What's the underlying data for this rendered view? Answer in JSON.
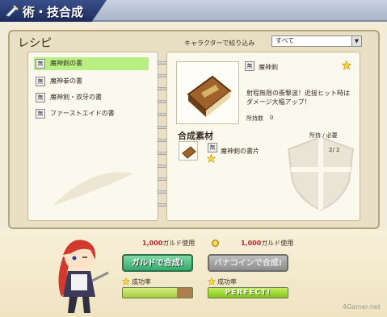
{
  "window": {
    "title": "術・技合成"
  },
  "recipe": {
    "heading": "レシピ",
    "filter_label": "キャラクターで絞り込み",
    "filter_value": "すべて",
    "items": [
      {
        "mu": "無",
        "name": "魔神剣の書"
      },
      {
        "mu": "無",
        "name": "魔神拳の書"
      },
      {
        "mu": "無",
        "name": "魔神剣・双牙の書"
      },
      {
        "mu": "無",
        "name": "ファーストエイドの書"
      }
    ]
  },
  "detail": {
    "mu": "無",
    "name": "魔神剣",
    "description_line1": "射程無限の衝撃波！近接ヒット時は",
    "description_line2": "ダメージ大幅アップ！",
    "owned_label": "所持数",
    "owned_value": "0"
  },
  "materials": {
    "heading": "合成素材",
    "column_label": "所持 / 必要",
    "items": [
      {
        "mu": "無",
        "name": "魔神剣の書片",
        "count": "2/ 2"
      }
    ]
  },
  "synthesis": {
    "gald_cost_num": "1,000",
    "gald_cost_unit": "ガルド使用",
    "coin_cost_num": "1,000",
    "coin_cost_unit": "ガルド使用",
    "gald_button": "ガルドで合成!",
    "coin_button": "バナコインで合成!",
    "rate_label_1": "成功率",
    "rate_label_2": "成功率",
    "rate1_fraction": 0.78,
    "rate2_text": "PERFECT!"
  },
  "colors": {
    "accent": "#b7ef83",
    "title_bg": "#1d2c5c",
    "gald_button": "#37a86b"
  },
  "watermark": "4Gamer.net"
}
